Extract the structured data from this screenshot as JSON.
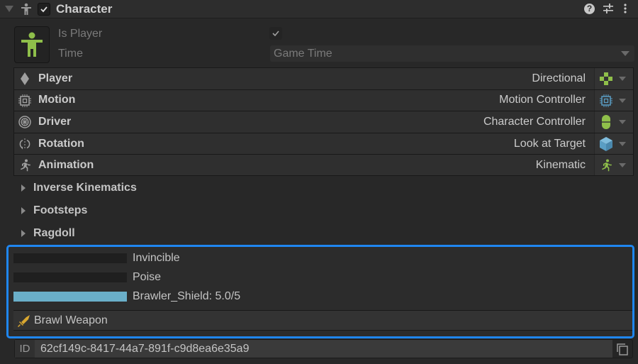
{
  "header": {
    "title": "Character",
    "enabled": true,
    "icons": [
      "fold-triangle-icon",
      "person-icon",
      "help-icon",
      "presets-icon",
      "more-icon"
    ]
  },
  "fields": {
    "is_player_label": "Is Player",
    "is_player_checked": true,
    "time_label": "Time",
    "time_value": "Game Time"
  },
  "rows": [
    {
      "label": "Player",
      "value": "Directional",
      "icon": "diamond-icon",
      "picker_icon": "gamepad-dpad-icon"
    },
    {
      "label": "Motion",
      "value": "Motion Controller",
      "icon": "chip-icon",
      "picker_icon": "chip-icon"
    },
    {
      "label": "Driver",
      "value": "Character Controller",
      "icon": "wheel-icon",
      "picker_icon": "capsule-icon"
    },
    {
      "label": "Rotation",
      "value": "Look at Target",
      "icon": "rotate-icon",
      "picker_icon": "cube-icon"
    },
    {
      "label": "Animation",
      "value": "Kinematic",
      "icon": "running-icon",
      "picker_icon": "running-icon"
    }
  ],
  "foldouts": [
    {
      "label": "Inverse Kinematics"
    },
    {
      "label": "Footsteps"
    },
    {
      "label": "Ragdoll"
    }
  ],
  "stats": [
    {
      "label": "Invincible",
      "fill": 0
    },
    {
      "label": "Poise",
      "fill": 0
    },
    {
      "label": "Brawler_Shield: 5.0/5",
      "fill": 1.0
    }
  ],
  "weapon": {
    "label": "Brawl Weapon"
  },
  "id": {
    "label": "ID",
    "value": "62cf149c-8417-44a7-891f-c9d8ea6e35a9"
  },
  "colors": {
    "accent": "#1f86f0",
    "green": "#8fbf4a",
    "blue": "#5a9ec4",
    "bar_fill": "#6aafc9"
  }
}
